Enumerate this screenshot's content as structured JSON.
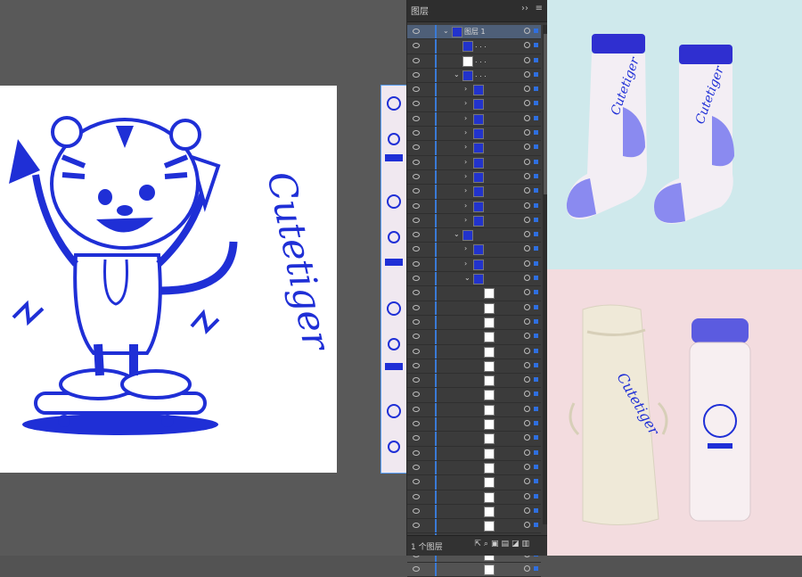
{
  "panel": {
    "tab_label": "图层",
    "menu_glyph": "››",
    "hamburger_glyph": "≡",
    "footer_label": "1 个图层",
    "top_layer_name": "图层 1",
    "placeholder_name": ". . ."
  },
  "colors": {
    "accent_blue": "#1f2fd6",
    "artboard": "#ffffff",
    "panel_bg": "#3b3b3b",
    "selection_blue": "#3a7ad6",
    "mint_bg": "#cfe9ec",
    "pink_bg": "#f3dcdf",
    "cup_lid": "#5b5be0"
  },
  "artwork": {
    "lettering": "Cutetiger"
  },
  "mockups": {
    "sock_text": "Cutetiger",
    "bag_text": "Cutetiger"
  }
}
